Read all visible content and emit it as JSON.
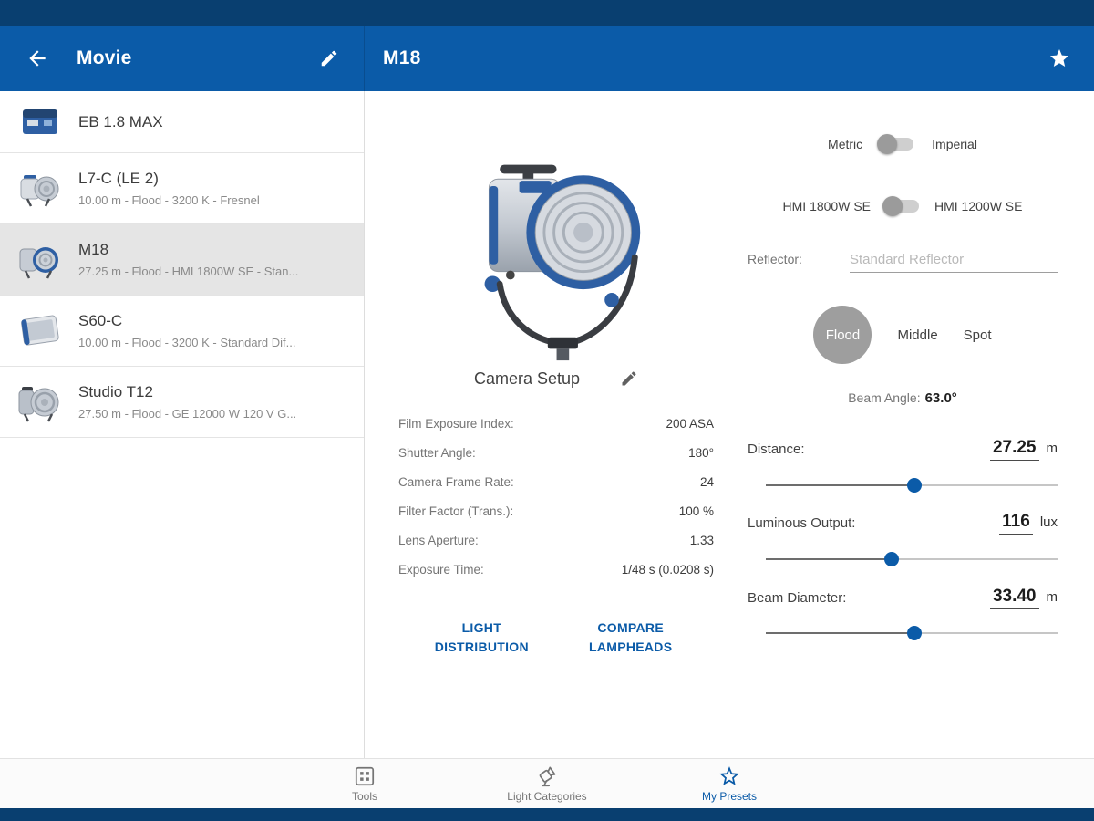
{
  "colors": {
    "primary": "#0b5ba8",
    "status_bar": "#093f70",
    "selected_row": "#e5e5e5",
    "accent_text": "#0b5ba8"
  },
  "header": {
    "group_title": "Movie",
    "detail_title": "M18"
  },
  "icons": {
    "back": "arrow-left",
    "edit": "pencil",
    "favorite": "star",
    "tools": "grid",
    "light_categories": "lamphead",
    "my_presets": "star-outline"
  },
  "sidebar": {
    "items": [
      {
        "title": "EB 1.8 MAX",
        "subtitle": "",
        "selected": false
      },
      {
        "title": "L7-C (LE 2)",
        "subtitle": "10.00 m - Flood - 3200 K - Fresnel",
        "selected": false
      },
      {
        "title": "M18",
        "subtitle": "27.25 m - Flood - HMI 1800W SE - Stan...",
        "selected": true
      },
      {
        "title": "S60-C",
        "subtitle": "10.00 m - Flood - 3200 K - Standard Dif...",
        "selected": false
      },
      {
        "title": "Studio T12",
        "subtitle": "27.50 m - Flood - GE 12000 W 120 V G...",
        "selected": false
      }
    ]
  },
  "main": {
    "units_toggle": {
      "left": "Metric",
      "right": "Imperial",
      "selected": "Metric"
    },
    "lamp_toggle": {
      "left": "HMI 1800W SE",
      "right": "HMI 1200W SE",
      "selected": "HMI 1800W SE"
    },
    "reflector": {
      "label": "Reflector:",
      "value": "Standard Reflector"
    },
    "beam_modes": {
      "flood": "Flood",
      "middle": "Middle",
      "spot": "Spot",
      "selected": "Flood"
    },
    "beam_angle": {
      "label": "Beam Angle:",
      "value": "63.0°"
    },
    "sliders": [
      {
        "label": "Distance:",
        "value": "27.25",
        "unit": "m",
        "pos": 0.51
      },
      {
        "label": "Luminous Output:",
        "value": "116",
        "unit": "lux",
        "pos": 0.43
      },
      {
        "label": "Beam Diameter:",
        "value": "33.40",
        "unit": "m",
        "pos": 0.51
      }
    ],
    "camera_setup": {
      "title": "Camera Setup",
      "rows": [
        {
          "label": "Film Exposure Index:",
          "value": "200 ASA"
        },
        {
          "label": "Shutter Angle:",
          "value": "180°"
        },
        {
          "label": "Camera Frame Rate:",
          "value": "24"
        },
        {
          "label": "Filter Factor (Trans.):",
          "value": "100 %"
        },
        {
          "label": "Lens Aperture:",
          "value": "1.33"
        },
        {
          "label": "Exposure Time:",
          "value": "1/48 s (0.0208 s)"
        }
      ]
    },
    "actions": {
      "light_distribution": "LIGHT DISTRIBUTION",
      "compare_lampheads": "COMPARE LAMPHEADS"
    }
  },
  "tab_bar": {
    "items": [
      {
        "label": "Tools",
        "active": false
      },
      {
        "label": "Light Categories",
        "active": false
      },
      {
        "label": "My Presets",
        "active": true
      }
    ]
  }
}
